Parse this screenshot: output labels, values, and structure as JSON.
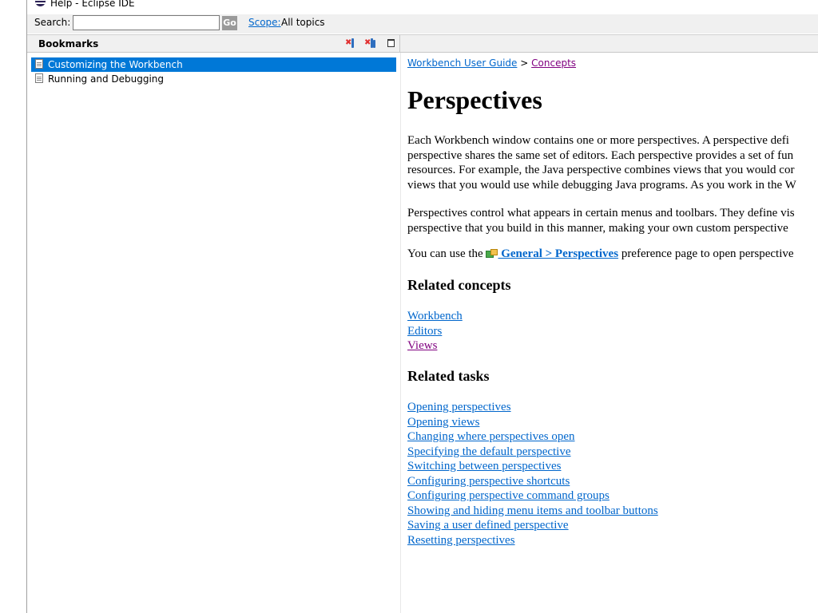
{
  "window": {
    "title": "Help - Eclipse IDE"
  },
  "search": {
    "label": "Search:",
    "value": "",
    "go_label": "Go",
    "scope_label": "Scope:",
    "scope_value": "All topics"
  },
  "view": {
    "title": "Bookmarks"
  },
  "bookmarks": [
    {
      "label": "Customizing the Workbench",
      "selected": true
    },
    {
      "label": "Running and Debugging",
      "selected": false
    }
  ],
  "content": {
    "breadcrumb": {
      "link1": "Workbench User Guide",
      "separator": ">",
      "link2": "Concepts"
    },
    "title": "Perspectives",
    "para1_lines": [
      "Each Workbench window contains one or more perspectives. A perspective defi",
      "perspective shares the same set of editors. Each perspective provides a set of fun",
      "resources. For example, the Java perspective combines views that you would cor",
      "views that you would use while debugging Java programs. As you work in the W"
    ],
    "para2_lines": [
      "Perspectives control what appears in certain menus and toolbars. They define vis",
      "perspective that you build in this manner, making your own custom perspective"
    ],
    "para3": {
      "before": "You can use the ",
      "link": " General > Perspectives",
      "after": " preference page to open perspective"
    },
    "related_concepts": {
      "heading": "Related concepts",
      "links": [
        "Workbench",
        "Editors",
        "Views"
      ]
    },
    "related_tasks": {
      "heading": "Related tasks",
      "links": [
        "Opening perspectives",
        "Opening views",
        "Changing where perspectives open",
        "Specifying the default perspective",
        "Switching between perspectives",
        "Configuring perspective shortcuts",
        "Configuring perspective command groups",
        "Showing and hiding menu items and toolbar buttons",
        "Saving a user defined perspective",
        "Resetting perspectives"
      ]
    }
  }
}
